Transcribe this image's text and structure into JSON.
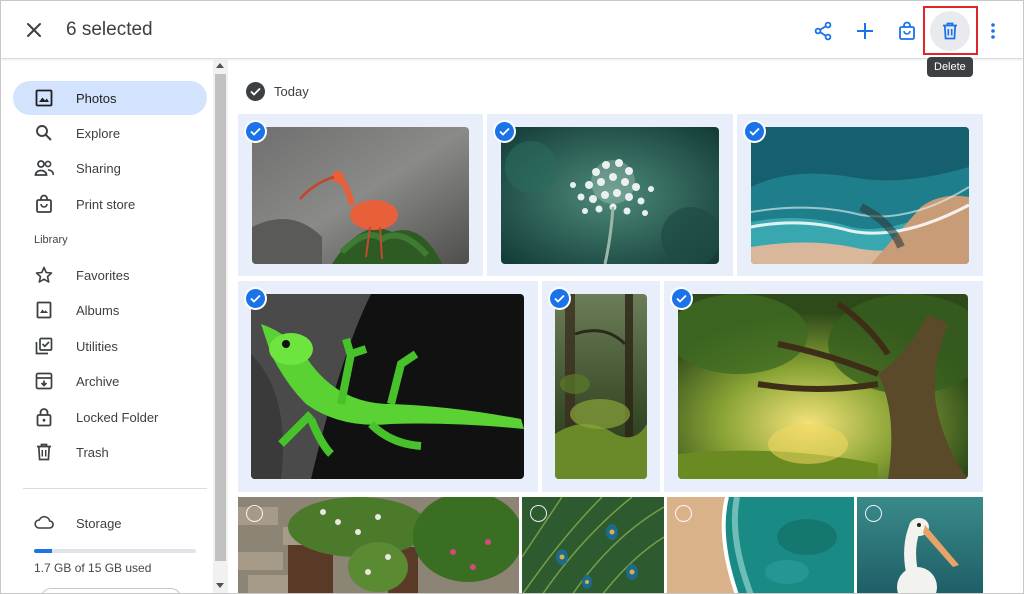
{
  "header": {
    "selected_text": "6 selected",
    "tooltip": "Delete",
    "icons": [
      "close-icon",
      "share-icon",
      "add-icon",
      "shopping-bag-icon",
      "trash-icon",
      "more-vert-icon"
    ]
  },
  "sidebar": {
    "items": [
      {
        "label": "Photos",
        "icon": "photo-icon",
        "active": true
      },
      {
        "label": "Explore",
        "icon": "search-icon"
      },
      {
        "label": "Sharing",
        "icon": "people-icon"
      },
      {
        "label": "Print store",
        "icon": "shopping-bag-icon"
      }
    ],
    "library_label": "Library",
    "library_items": [
      {
        "label": "Favorites",
        "icon": "star-icon"
      },
      {
        "label": "Albums",
        "icon": "album-icon"
      },
      {
        "label": "Utilities",
        "icon": "utilities-icon"
      },
      {
        "label": "Archive",
        "icon": "archive-icon"
      },
      {
        "label": "Locked Folder",
        "icon": "lock-icon"
      },
      {
        "label": "Trash",
        "icon": "trash-icon"
      }
    ],
    "storage": {
      "label": "Storage",
      "icon": "cloud-icon",
      "used_text": "1.7 GB of 15 GB used",
      "used_fraction": 0.113
    }
  },
  "main": {
    "date_label": "Today",
    "photos": [
      {
        "subject": "scarlet ibis",
        "selected": true
      },
      {
        "subject": "white flower",
        "selected": true
      },
      {
        "subject": "aerial beach waves",
        "selected": true
      },
      {
        "subject": "green lizard",
        "selected": true
      },
      {
        "subject": "forest",
        "selected": true
      },
      {
        "subject": "large tree",
        "selected": true
      },
      {
        "subject": "ivy covered cottage",
        "selected": false
      },
      {
        "subject": "peacock feathers",
        "selected": false
      },
      {
        "subject": "aerial coastline",
        "selected": false
      },
      {
        "subject": "pelican",
        "selected": false
      }
    ]
  }
}
